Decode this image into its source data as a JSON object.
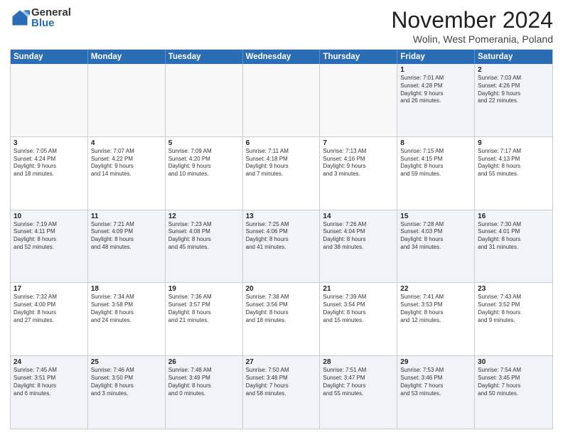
{
  "logo": {
    "general": "General",
    "blue": "Blue"
  },
  "header": {
    "title": "November 2024",
    "location": "Wolin, West Pomerania, Poland"
  },
  "days": [
    "Sunday",
    "Monday",
    "Tuesday",
    "Wednesday",
    "Thursday",
    "Friday",
    "Saturday"
  ],
  "weeks": [
    [
      {
        "day": "",
        "lines": []
      },
      {
        "day": "",
        "lines": []
      },
      {
        "day": "",
        "lines": []
      },
      {
        "day": "",
        "lines": []
      },
      {
        "day": "",
        "lines": []
      },
      {
        "day": "1",
        "lines": [
          "Sunrise: 7:01 AM",
          "Sunset: 4:28 PM",
          "Daylight: 9 hours",
          "and 26 minutes."
        ]
      },
      {
        "day": "2",
        "lines": [
          "Sunrise: 7:03 AM",
          "Sunset: 4:26 PM",
          "Daylight: 9 hours",
          "and 22 minutes."
        ]
      }
    ],
    [
      {
        "day": "3",
        "lines": [
          "Sunrise: 7:05 AM",
          "Sunset: 4:24 PM",
          "Daylight: 9 hours",
          "and 18 minutes."
        ]
      },
      {
        "day": "4",
        "lines": [
          "Sunrise: 7:07 AM",
          "Sunset: 4:22 PM",
          "Daylight: 9 hours",
          "and 14 minutes."
        ]
      },
      {
        "day": "5",
        "lines": [
          "Sunrise: 7:09 AM",
          "Sunset: 4:20 PM",
          "Daylight: 9 hours",
          "and 10 minutes."
        ]
      },
      {
        "day": "6",
        "lines": [
          "Sunrise: 7:11 AM",
          "Sunset: 4:18 PM",
          "Daylight: 9 hours",
          "and 7 minutes."
        ]
      },
      {
        "day": "7",
        "lines": [
          "Sunrise: 7:13 AM",
          "Sunset: 4:16 PM",
          "Daylight: 9 hours",
          "and 3 minutes."
        ]
      },
      {
        "day": "8",
        "lines": [
          "Sunrise: 7:15 AM",
          "Sunset: 4:15 PM",
          "Daylight: 8 hours",
          "and 59 minutes."
        ]
      },
      {
        "day": "9",
        "lines": [
          "Sunrise: 7:17 AM",
          "Sunset: 4:13 PM",
          "Daylight: 8 hours",
          "and 55 minutes."
        ]
      }
    ],
    [
      {
        "day": "10",
        "lines": [
          "Sunrise: 7:19 AM",
          "Sunset: 4:11 PM",
          "Daylight: 8 hours",
          "and 52 minutes."
        ]
      },
      {
        "day": "11",
        "lines": [
          "Sunrise: 7:21 AM",
          "Sunset: 4:09 PM",
          "Daylight: 8 hours",
          "and 48 minutes."
        ]
      },
      {
        "day": "12",
        "lines": [
          "Sunrise: 7:23 AM",
          "Sunset: 4:08 PM",
          "Daylight: 8 hours",
          "and 45 minutes."
        ]
      },
      {
        "day": "13",
        "lines": [
          "Sunrise: 7:25 AM",
          "Sunset: 4:06 PM",
          "Daylight: 8 hours",
          "and 41 minutes."
        ]
      },
      {
        "day": "14",
        "lines": [
          "Sunrise: 7:26 AM",
          "Sunset: 4:04 PM",
          "Daylight: 8 hours",
          "and 38 minutes."
        ]
      },
      {
        "day": "15",
        "lines": [
          "Sunrise: 7:28 AM",
          "Sunset: 4:03 PM",
          "Daylight: 8 hours",
          "and 34 minutes."
        ]
      },
      {
        "day": "16",
        "lines": [
          "Sunrise: 7:30 AM",
          "Sunset: 4:01 PM",
          "Daylight: 8 hours",
          "and 31 minutes."
        ]
      }
    ],
    [
      {
        "day": "17",
        "lines": [
          "Sunrise: 7:32 AM",
          "Sunset: 4:00 PM",
          "Daylight: 8 hours",
          "and 27 minutes."
        ]
      },
      {
        "day": "18",
        "lines": [
          "Sunrise: 7:34 AM",
          "Sunset: 3:58 PM",
          "Daylight: 8 hours",
          "and 24 minutes."
        ]
      },
      {
        "day": "19",
        "lines": [
          "Sunrise: 7:36 AM",
          "Sunset: 3:57 PM",
          "Daylight: 8 hours",
          "and 21 minutes."
        ]
      },
      {
        "day": "20",
        "lines": [
          "Sunrise: 7:38 AM",
          "Sunset: 3:56 PM",
          "Daylight: 8 hours",
          "and 18 minutes."
        ]
      },
      {
        "day": "21",
        "lines": [
          "Sunrise: 7:39 AM",
          "Sunset: 3:54 PM",
          "Daylight: 8 hours",
          "and 15 minutes."
        ]
      },
      {
        "day": "22",
        "lines": [
          "Sunrise: 7:41 AM",
          "Sunset: 3:53 PM",
          "Daylight: 8 hours",
          "and 12 minutes."
        ]
      },
      {
        "day": "23",
        "lines": [
          "Sunrise: 7:43 AM",
          "Sunset: 3:52 PM",
          "Daylight: 8 hours",
          "and 9 minutes."
        ]
      }
    ],
    [
      {
        "day": "24",
        "lines": [
          "Sunrise: 7:45 AM",
          "Sunset: 3:51 PM",
          "Daylight: 8 hours",
          "and 6 minutes."
        ]
      },
      {
        "day": "25",
        "lines": [
          "Sunrise: 7:46 AM",
          "Sunset: 3:50 PM",
          "Daylight: 8 hours",
          "and 3 minutes."
        ]
      },
      {
        "day": "26",
        "lines": [
          "Sunrise: 7:48 AM",
          "Sunset: 3:49 PM",
          "Daylight: 8 hours",
          "and 0 minutes."
        ]
      },
      {
        "day": "27",
        "lines": [
          "Sunrise: 7:50 AM",
          "Sunset: 3:48 PM",
          "Daylight: 7 hours",
          "and 58 minutes."
        ]
      },
      {
        "day": "28",
        "lines": [
          "Sunrise: 7:51 AM",
          "Sunset: 3:47 PM",
          "Daylight: 7 hours",
          "and 55 minutes."
        ]
      },
      {
        "day": "29",
        "lines": [
          "Sunrise: 7:53 AM",
          "Sunset: 3:46 PM",
          "Daylight: 7 hours",
          "and 53 minutes."
        ]
      },
      {
        "day": "30",
        "lines": [
          "Sunrise: 7:54 AM",
          "Sunset: 3:45 PM",
          "Daylight: 7 hours",
          "and 50 minutes."
        ]
      }
    ]
  ]
}
